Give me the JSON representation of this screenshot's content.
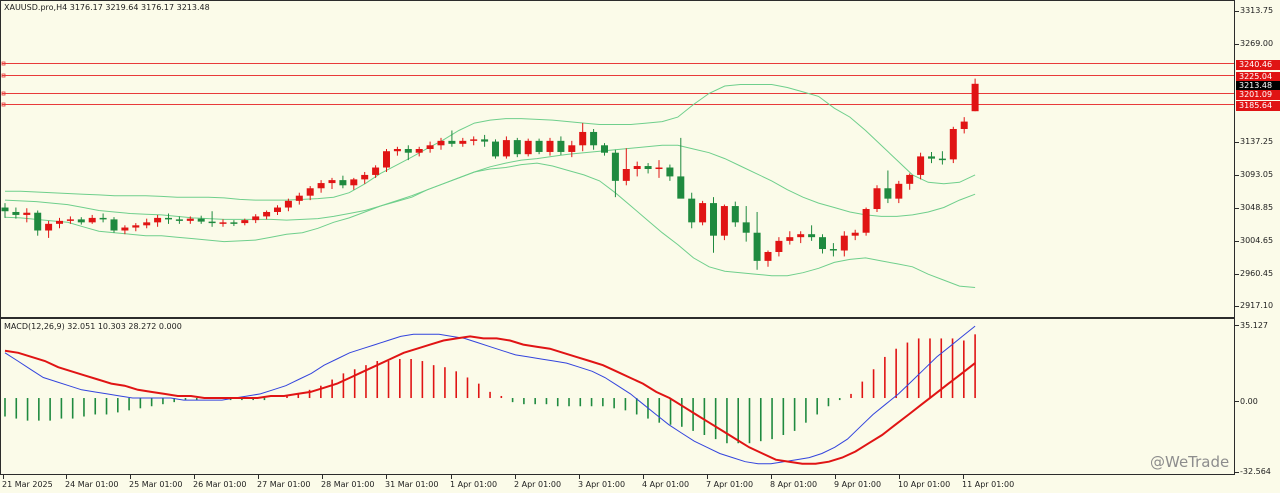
{
  "chart": {
    "header": "XAUUSD.pro,H4  3176.17 3219.64 3176.17 3213.48",
    "macd_header": "MACD(12,26,9) 32.051 10.303 28.272 0.000",
    "watermark": "@WeTrade",
    "colors": {
      "background": "#fbfbe9",
      "bull_candle": "#e01414",
      "bear_candle": "#1f8a3f",
      "bollinger": "#6fcf8c",
      "macd_line": "#3344dd",
      "signal_line": "#e01414",
      "level_line": "#e83a3a",
      "current_price_tag": "#000000"
    }
  },
  "price_axis": {
    "labels": [
      "3313.75",
      "3269.00",
      "3137.25",
      "3093.05",
      "3048.85",
      "3004.65",
      "2960.45",
      "2917.10"
    ],
    "level_tags": [
      "3240.46",
      "3225.04",
      "3201.09",
      "3185.64"
    ],
    "current_price": "3213.48"
  },
  "macd_axis": {
    "labels": [
      "35.127",
      "0.00",
      "-32.564"
    ]
  },
  "time_axis": {
    "labels": [
      "21 Mar 2025",
      "24 Mar 01:00",
      "25 Mar 01:00",
      "26 Mar 01:00",
      "27 Mar 01:00",
      "28 Mar 01:00",
      "31 Mar 01:00",
      "1 Apr 01:00",
      "2 Apr 01:00",
      "3 Apr 01:00",
      "4 Apr 01:00",
      "7 Apr 01:00",
      "8 Apr 01:00",
      "9 Apr 01:00",
      "10 Apr 01:00",
      "11 Apr 01:00"
    ]
  },
  "chart_data": {
    "type": "candlestick",
    "symbol": "XAUUSD.pro",
    "timeframe": "H4",
    "price_range": [
      2905,
      3318
    ],
    "macd_range": [
      -36,
      37
    ],
    "horizontal_levels": [
      3240.46,
      3225.04,
      3201.09,
      3185.64
    ],
    "candles": [
      {
        "o": 3046,
        "h": 3052,
        "l": 3032,
        "c": 3041
      },
      {
        "o": 3040,
        "h": 3046,
        "l": 3031,
        "c": 3036
      },
      {
        "o": 3036,
        "h": 3045,
        "l": 3026,
        "c": 3039
      },
      {
        "o": 3039,
        "h": 3042,
        "l": 3008,
        "c": 3015
      },
      {
        "o": 3015,
        "h": 3028,
        "l": 3005,
        "c": 3024
      },
      {
        "o": 3024,
        "h": 3032,
        "l": 3018,
        "c": 3028
      },
      {
        "o": 3028,
        "h": 3034,
        "l": 3024,
        "c": 3030
      },
      {
        "o": 3030,
        "h": 3033,
        "l": 3023,
        "c": 3026
      },
      {
        "o": 3026,
        "h": 3036,
        "l": 3024,
        "c": 3032
      },
      {
        "o": 3032,
        "h": 3038,
        "l": 3026,
        "c": 3030
      },
      {
        "o": 3030,
        "h": 3033,
        "l": 3012,
        "c": 3015
      },
      {
        "o": 3015,
        "h": 3022,
        "l": 3010,
        "c": 3019
      },
      {
        "o": 3019,
        "h": 3025,
        "l": 3014,
        "c": 3022
      },
      {
        "o": 3022,
        "h": 3031,
        "l": 3018,
        "c": 3026
      },
      {
        "o": 3026,
        "h": 3036,
        "l": 3020,
        "c": 3032
      },
      {
        "o": 3032,
        "h": 3038,
        "l": 3024,
        "c": 3030
      },
      {
        "o": 3030,
        "h": 3034,
        "l": 3024,
        "c": 3028
      },
      {
        "o": 3028,
        "h": 3034,
        "l": 3024,
        "c": 3031
      },
      {
        "o": 3031,
        "h": 3035,
        "l": 3024,
        "c": 3027
      },
      {
        "o": 3027,
        "h": 3041,
        "l": 3020,
        "c": 3025
      },
      {
        "o": 3025,
        "h": 3030,
        "l": 3020,
        "c": 3026
      },
      {
        "o": 3026,
        "h": 3029,
        "l": 3021,
        "c": 3025
      },
      {
        "o": 3025,
        "h": 3031,
        "l": 3022,
        "c": 3029
      },
      {
        "o": 3029,
        "h": 3037,
        "l": 3025,
        "c": 3034
      },
      {
        "o": 3034,
        "h": 3042,
        "l": 3030,
        "c": 3040
      },
      {
        "o": 3040,
        "h": 3049,
        "l": 3036,
        "c": 3046
      },
      {
        "o": 3046,
        "h": 3058,
        "l": 3041,
        "c": 3055
      },
      {
        "o": 3055,
        "h": 3066,
        "l": 3050,
        "c": 3062
      },
      {
        "o": 3062,
        "h": 3075,
        "l": 3056,
        "c": 3072
      },
      {
        "o": 3072,
        "h": 3083,
        "l": 3066,
        "c": 3079
      },
      {
        "o": 3079,
        "h": 3086,
        "l": 3071,
        "c": 3083
      },
      {
        "o": 3083,
        "h": 3089,
        "l": 3072,
        "c": 3076
      },
      {
        "o": 3076,
        "h": 3086,
        "l": 3070,
        "c": 3084
      },
      {
        "o": 3084,
        "h": 3094,
        "l": 3078,
        "c": 3090
      },
      {
        "o": 3090,
        "h": 3103,
        "l": 3086,
        "c": 3100
      },
      {
        "o": 3100,
        "h": 3125,
        "l": 3094,
        "c": 3122
      },
      {
        "o": 3122,
        "h": 3128,
        "l": 3116,
        "c": 3125
      },
      {
        "o": 3125,
        "h": 3130,
        "l": 3110,
        "c": 3120
      },
      {
        "o": 3120,
        "h": 3128,
        "l": 3115,
        "c": 3125
      },
      {
        "o": 3125,
        "h": 3135,
        "l": 3120,
        "c": 3130
      },
      {
        "o": 3130,
        "h": 3140,
        "l": 3124,
        "c": 3136
      },
      {
        "o": 3136,
        "h": 3150,
        "l": 3128,
        "c": 3132
      },
      {
        "o": 3132,
        "h": 3140,
        "l": 3128,
        "c": 3136
      },
      {
        "o": 3136,
        "h": 3142,
        "l": 3130,
        "c": 3138
      },
      {
        "o": 3138,
        "h": 3144,
        "l": 3128,
        "c": 3135
      },
      {
        "o": 3135,
        "h": 3138,
        "l": 3112,
        "c": 3115
      },
      {
        "o": 3115,
        "h": 3142,
        "l": 3112,
        "c": 3137
      },
      {
        "o": 3137,
        "h": 3140,
        "l": 3114,
        "c": 3118
      },
      {
        "o": 3118,
        "h": 3139,
        "l": 3115,
        "c": 3136
      },
      {
        "o": 3136,
        "h": 3139,
        "l": 3118,
        "c": 3121
      },
      {
        "o": 3121,
        "h": 3140,
        "l": 3116,
        "c": 3136
      },
      {
        "o": 3136,
        "h": 3142,
        "l": 3117,
        "c": 3121
      },
      {
        "o": 3121,
        "h": 3136,
        "l": 3114,
        "c": 3130
      },
      {
        "o": 3130,
        "h": 3160,
        "l": 3122,
        "c": 3148
      },
      {
        "o": 3148,
        "h": 3152,
        "l": 3124,
        "c": 3130
      },
      {
        "o": 3130,
        "h": 3133,
        "l": 3116,
        "c": 3120
      },
      {
        "o": 3120,
        "h": 3124,
        "l": 3060,
        "c": 3082
      },
      {
        "o": 3082,
        "h": 3126,
        "l": 3076,
        "c": 3098
      },
      {
        "o": 3098,
        "h": 3108,
        "l": 3088,
        "c": 3102
      },
      {
        "o": 3102,
        "h": 3106,
        "l": 3092,
        "c": 3098
      },
      {
        "o": 3098,
        "h": 3110,
        "l": 3086,
        "c": 3100
      },
      {
        "o": 3100,
        "h": 3104,
        "l": 3082,
        "c": 3088
      },
      {
        "o": 3088,
        "h": 3140,
        "l": 3064,
        "c": 3058
      },
      {
        "o": 3058,
        "h": 3066,
        "l": 3018,
        "c": 3026
      },
      {
        "o": 3026,
        "h": 3055,
        "l": 3022,
        "c": 3052
      },
      {
        "o": 3052,
        "h": 3060,
        "l": 2985,
        "c": 3008
      },
      {
        "o": 3008,
        "h": 3050,
        "l": 3002,
        "c": 3048
      },
      {
        "o": 3048,
        "h": 3054,
        "l": 3020,
        "c": 3026
      },
      {
        "o": 3026,
        "h": 3048,
        "l": 3000,
        "c": 3012
      },
      {
        "o": 3012,
        "h": 3040,
        "l": 2962,
        "c": 2974
      },
      {
        "o": 2974,
        "h": 2988,
        "l": 2966,
        "c": 2986
      },
      {
        "o": 2986,
        "h": 3006,
        "l": 2980,
        "c": 3001
      },
      {
        "o": 3001,
        "h": 3014,
        "l": 2996,
        "c": 3006
      },
      {
        "o": 3006,
        "h": 3014,
        "l": 2998,
        "c": 3010
      },
      {
        "o": 3010,
        "h": 3022,
        "l": 3001,
        "c": 3006
      },
      {
        "o": 3006,
        "h": 3010,
        "l": 2984,
        "c": 2990
      },
      {
        "o": 2990,
        "h": 2998,
        "l": 2980,
        "c": 2988
      },
      {
        "o": 2988,
        "h": 3014,
        "l": 2980,
        "c": 3008
      },
      {
        "o": 3008,
        "h": 3016,
        "l": 3002,
        "c": 3012
      },
      {
        "o": 3012,
        "h": 3046,
        "l": 3008,
        "c": 3044
      },
      {
        "o": 3044,
        "h": 3076,
        "l": 3040,
        "c": 3072
      },
      {
        "o": 3072,
        "h": 3096,
        "l": 3052,
        "c": 3058
      },
      {
        "o": 3058,
        "h": 3082,
        "l": 3052,
        "c": 3078
      },
      {
        "o": 3078,
        "h": 3092,
        "l": 3070,
        "c": 3090
      },
      {
        "o": 3090,
        "h": 3120,
        "l": 3084,
        "c": 3115
      },
      {
        "o": 3115,
        "h": 3121,
        "l": 3106,
        "c": 3112
      },
      {
        "o": 3112,
        "h": 3122,
        "l": 3104,
        "c": 3111
      },
      {
        "o": 3111,
        "h": 3155,
        "l": 3106,
        "c": 3152
      },
      {
        "o": 3152,
        "h": 3168,
        "l": 3146,
        "c": 3162
      },
      {
        "o": 3176,
        "h": 3220,
        "l": 3176,
        "c": 3213
      }
    ],
    "bollinger": {
      "upper": [
        3068,
        3068,
        3067,
        3066,
        3065,
        3064,
        3063,
        3062,
        3062,
        3062,
        3061,
        3060,
        3060,
        3060,
        3059,
        3057,
        3056,
        3056,
        3056,
        3057,
        3058,
        3060,
        3066,
        3078,
        3092,
        3103,
        3114,
        3126,
        3137,
        3150,
        3160,
        3164,
        3166,
        3166,
        3165,
        3164,
        3162,
        3160,
        3158,
        3158,
        3158,
        3160,
        3162,
        3168,
        3185,
        3200,
        3210,
        3212,
        3212,
        3212,
        3208,
        3202,
        3196,
        3180,
        3168,
        3150,
        3130,
        3110,
        3090,
        3080,
        3078,
        3080,
        3090
      ],
      "middle": [
        3056,
        3055,
        3054,
        3052,
        3050,
        3046,
        3042,
        3040,
        3038,
        3037,
        3036,
        3034,
        3032,
        3031,
        3030,
        3030,
        3030,
        3030,
        3029,
        3030,
        3031,
        3034,
        3038,
        3042,
        3048,
        3055,
        3062,
        3070,
        3078,
        3086,
        3094,
        3101,
        3106,
        3110,
        3112,
        3115,
        3118,
        3120,
        3122,
        3124,
        3126,
        3128,
        3130,
        3130,
        3125,
        3120,
        3112,
        3102,
        3092,
        3082,
        3070,
        3060,
        3052,
        3046,
        3040,
        3036,
        3034,
        3034,
        3036,
        3040,
        3046,
        3056,
        3064
      ],
      "lower": [
        3033,
        3032,
        3030,
        3028,
        3026,
        3020,
        3014,
        3012,
        3010,
        3008,
        3008,
        3006,
        3004,
        3002,
        3000,
        3001,
        3002,
        3006,
        3010,
        3012,
        3018,
        3026,
        3032,
        3040,
        3048,
        3054,
        3060,
        3070,
        3078,
        3086,
        3094,
        3098,
        3100,
        3104,
        3106,
        3102,
        3096,
        3090,
        3082,
        3066,
        3048,
        3030,
        3012,
        2996,
        2978,
        2966,
        2960,
        2958,
        2956,
        2954,
        2954,
        2958,
        2964,
        2972,
        2976,
        2978,
        2974,
        2970,
        2966,
        2956,
        2948,
        2940,
        2938
      ]
    },
    "macd": {
      "histogram": [
        -9,
        -10,
        -11,
        -11,
        -11,
        -10,
        -10,
        -9,
        -8,
        -8,
        -7,
        -6,
        -5,
        -4,
        -3,
        -2,
        -1,
        -1,
        0,
        0,
        -1,
        -1,
        -1,
        -1,
        0,
        1,
        2,
        4,
        6,
        9,
        12,
        14,
        16,
        18,
        18,
        19,
        19,
        18,
        16,
        15,
        13,
        10,
        7,
        3,
        1,
        -2,
        -3,
        -3,
        -3,
        -4,
        -4,
        -4,
        -4,
        -4,
        -5,
        -6,
        -8,
        -10,
        -12,
        -13,
        -14,
        -16,
        -18,
        -20,
        -22,
        -22,
        -22,
        -21,
        -20,
        -18,
        -16,
        -12,
        -8,
        -4,
        -1,
        2,
        8,
        14,
        20,
        24,
        27,
        29,
        29,
        29,
        29,
        28,
        31
      ],
      "macd_line": [
        22,
        18,
        14,
        10,
        8,
        6,
        4,
        3,
        2,
        1,
        0,
        0,
        0,
        0,
        -1,
        -1,
        -1,
        -1,
        0,
        1,
        2,
        4,
        6,
        9,
        12,
        16,
        19,
        22,
        24,
        26,
        28,
        30,
        31,
        31,
        31,
        30,
        29,
        27,
        25,
        23,
        21,
        20,
        19,
        18,
        17,
        15,
        13,
        10,
        6,
        2,
        -3,
        -8,
        -13,
        -17,
        -21,
        -24,
        -27,
        -29,
        -31,
        -32,
        -32,
        -31,
        -30,
        -29,
        -27,
        -24,
        -20,
        -14,
        -8,
        -3,
        2,
        8,
        14,
        20,
        25,
        30,
        35
      ],
      "signal_line": [
        23,
        22,
        20,
        18,
        15,
        13,
        11,
        9,
        7,
        6,
        4,
        3,
        2,
        1,
        1,
        0,
        0,
        0,
        0,
        0,
        1,
        1,
        2,
        3,
        5,
        7,
        10,
        13,
        16,
        19,
        22,
        24,
        26,
        28,
        29,
        30,
        29,
        29,
        28,
        26,
        25,
        24,
        22,
        20,
        18,
        16,
        13,
        10,
        7,
        3,
        0,
        -4,
        -8,
        -12,
        -16,
        -20,
        -24,
        -27,
        -30,
        -31,
        -32,
        -32,
        -31,
        -29,
        -26,
        -22,
        -18,
        -13,
        -8,
        -3,
        2,
        7,
        12,
        17
      ]
    }
  }
}
